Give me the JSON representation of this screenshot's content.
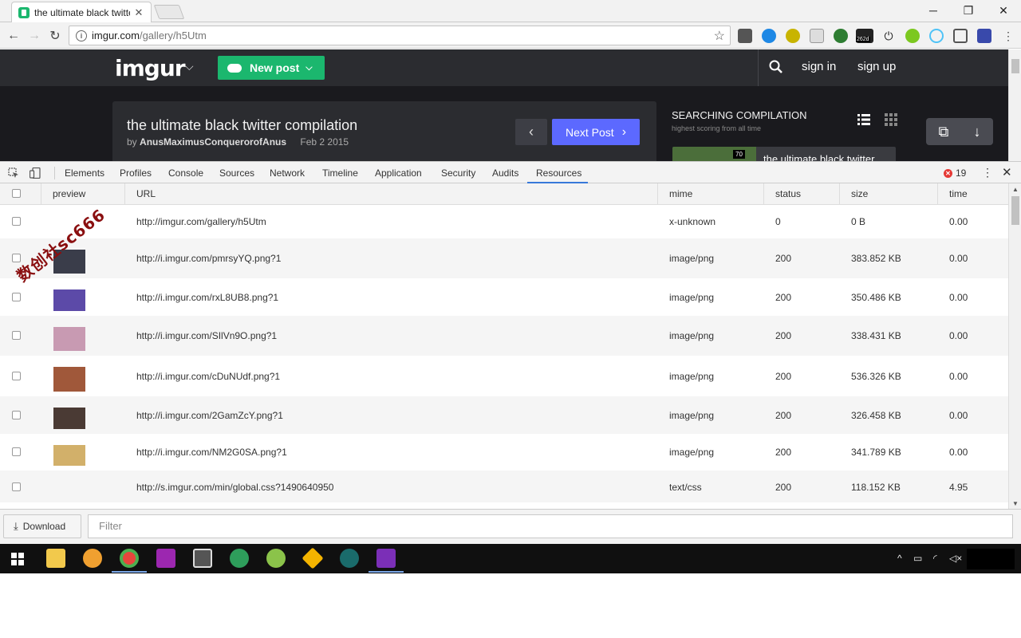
{
  "browser": {
    "tab_title": "the ultimate black twitter compilation",
    "tab_close": "✕",
    "url_host": "imgur.com",
    "url_path": "/gallery/h5Utm",
    "ext_badge": "262d"
  },
  "imgur": {
    "logo": "imgur",
    "new_post": "New post",
    "sign_in": "sign in",
    "sign_up": "sign up",
    "post_title": "the ultimate black twitter compilation",
    "by_prefix": "by",
    "author": "AnusMaximusConquerorofAnus",
    "date": "Feb 2 2015",
    "next_post": "Next Post",
    "side_heading": "SEARCHING COMPILATION",
    "side_sub": "highest scoring from all time",
    "side_item": "the ultimate black twitter",
    "side_item_badge": "70"
  },
  "devtools": {
    "tabs": [
      "Elements",
      "Profiles",
      "Console",
      "Sources",
      "Network",
      "Timeline",
      "Application",
      "Security",
      "Audits",
      "Resources"
    ],
    "active_tab": "Resources",
    "error_count": "19",
    "columns": [
      "preview",
      "URL",
      "mime",
      "status",
      "size",
      "time"
    ],
    "rows": [
      {
        "url": "http://imgur.com/gallery/h5Utm",
        "mime": "x-unknown",
        "status": "0",
        "size": "0 B",
        "time": "0.00",
        "thumb": ""
      },
      {
        "url": "http://i.imgur.com/pmrsyYQ.png?1",
        "mime": "image/png",
        "status": "200",
        "size": "383.852 KB",
        "time": "0.00",
        "thumb": "#3a3d4a"
      },
      {
        "url": "http://i.imgur.com/rxL8UB8.png?1",
        "mime": "image/png",
        "status": "200",
        "size": "350.486 KB",
        "time": "0.00",
        "thumb": "#5c4aa8"
      },
      {
        "url": "http://i.imgur.com/SIlVn9O.png?1",
        "mime": "image/png",
        "status": "200",
        "size": "338.431 KB",
        "time": "0.00",
        "thumb": "#c89ab2"
      },
      {
        "url": "http://i.imgur.com/cDuNUdf.png?1",
        "mime": "image/png",
        "status": "200",
        "size": "536.326 KB",
        "time": "0.00",
        "thumb": "#a0583a"
      },
      {
        "url": "http://i.imgur.com/2GamZcY.png?1",
        "mime": "image/png",
        "status": "200",
        "size": "326.458 KB",
        "time": "0.00",
        "thumb": "#4a3a34"
      },
      {
        "url": "http://i.imgur.com/NM2G0SA.png?1",
        "mime": "image/png",
        "status": "200",
        "size": "341.789 KB",
        "time": "0.00",
        "thumb": "#d2b06a"
      },
      {
        "url": "http://s.imgur.com/min/global.css?1490640950",
        "mime": "text/css",
        "status": "200",
        "size": "118.152 KB",
        "time": "4.95",
        "thumb": ""
      }
    ],
    "download": "Download",
    "filter_placeholder": "Filter"
  },
  "watermark": "数创社sc666",
  "colors": {
    "imgur_green": "#1bb76e",
    "next_blue": "#5c69ff",
    "active_tab_underline": "#3879d9"
  }
}
